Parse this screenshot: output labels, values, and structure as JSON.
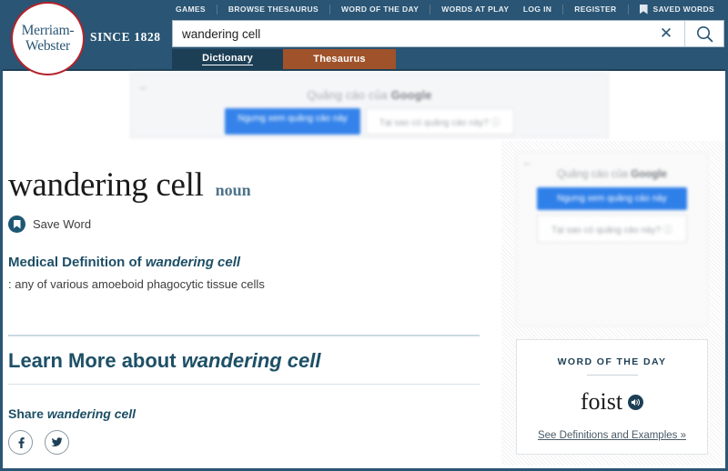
{
  "header": {
    "logo": {
      "line1": "Merriam-",
      "line2": "Webster",
      "since": "SINCE 1828"
    },
    "utility_nav_left": [
      {
        "label": "GAMES"
      },
      {
        "label": "BROWSE THESAURUS"
      },
      {
        "label": "WORD OF THE DAY"
      },
      {
        "label": "WORDS AT PLAY"
      }
    ],
    "utility_nav_right": [
      {
        "label": "LOG IN"
      },
      {
        "label": "REGISTER"
      },
      {
        "label": "SAVED WORDS"
      }
    ],
    "search": {
      "value": "wandering cell",
      "placeholder": "Search the dictionary",
      "clear_icon": "close-x-icon",
      "submit_icon": "search-magnifier-icon"
    },
    "tabs": [
      {
        "label": "Dictionary",
        "active": true
      },
      {
        "label": "Thesaurus",
        "active": false
      }
    ]
  },
  "banner_ad": {
    "back_arrow": "←",
    "title_prefix": "Quảng cáo của ",
    "title_brand": "Google",
    "button_primary": "Ngưng xem quảng cáo này",
    "button_secondary": "Tại sao có quảng cáo này? ⓘ"
  },
  "sidebar_ad": {
    "back_arrow": "←",
    "title_prefix": "Quảng cáo của ",
    "title_brand": "Google",
    "button_primary": "Ngưng xem quảng cáo này",
    "button_secondary": "Tại sao có quảng cáo này? ⓘ"
  },
  "entry": {
    "headword": "wandering cell",
    "part_of_speech": "noun",
    "save_word_label": "Save Word",
    "definition_heading_prefix": "Medical Definition of ",
    "definition_heading_word": "wandering cell",
    "definition_text": ": any of various amoeboid phagocytic tissue cells",
    "learn_more_prefix": "Learn More about ",
    "learn_more_word": "wandering cell",
    "share_prefix": "Share ",
    "share_word": "wandering cell",
    "share_buttons": [
      {
        "name": "facebook",
        "glyph": "f"
      },
      {
        "name": "twitter",
        "glyph": "🐦"
      }
    ]
  },
  "word_of_the_day": {
    "label": "WORD OF THE DAY",
    "word": "foist",
    "audio_icon": "speaker-audio-icon",
    "link_label": "See Definitions and Examples",
    "link_chevron": " »"
  },
  "colors": {
    "header_blue": "#2a5574",
    "tab_active_blue": "#1d3f56",
    "thesaurus_brown": "#a0522a",
    "logo_red": "#b4232c",
    "heading_teal": "#1d4f66",
    "ad_blue": "#1a73e8"
  }
}
